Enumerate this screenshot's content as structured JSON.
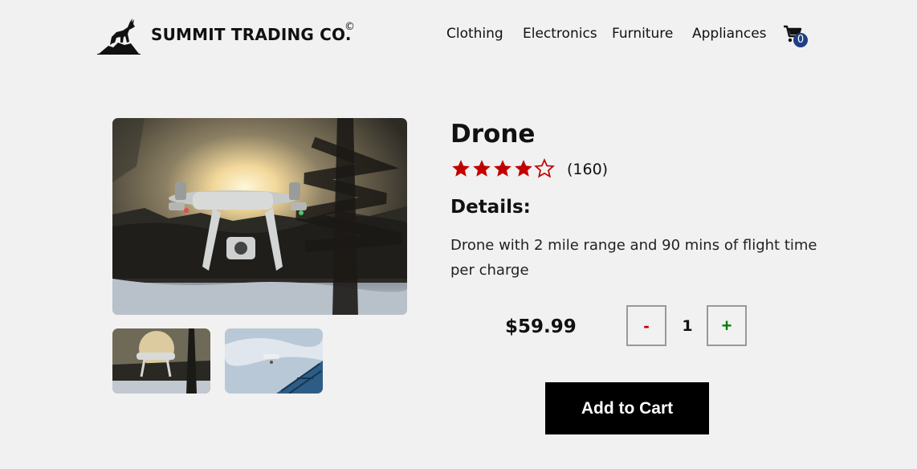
{
  "brand": {
    "name": "SUMMIT TRADING CO.",
    "mark": "©",
    "logo_icon": "mountain-goat-icon"
  },
  "nav": {
    "items": [
      {
        "label": "Clothing"
      },
      {
        "label": "Electronics"
      },
      {
        "label": "Furniture"
      },
      {
        "label": "Appliances"
      }
    ],
    "cart": {
      "icon": "cart-icon",
      "count": "0"
    }
  },
  "product": {
    "title": "Drone",
    "rating": 4,
    "rating_max": 5,
    "rating_count": "(160)",
    "details_heading": "Details:",
    "description": "Drone with 2 mile range and 90 mins of flight time per charge",
    "price": "$59.99",
    "quantity": "1",
    "minus_label": "-",
    "plus_label": "+",
    "add_to_cart_label": "Add to Cart"
  },
  "colors": {
    "star": "#c20000",
    "badge": "#1d3f86",
    "minus": "#c20000",
    "plus": "#0a7a0a",
    "button_bg": "#000000"
  }
}
